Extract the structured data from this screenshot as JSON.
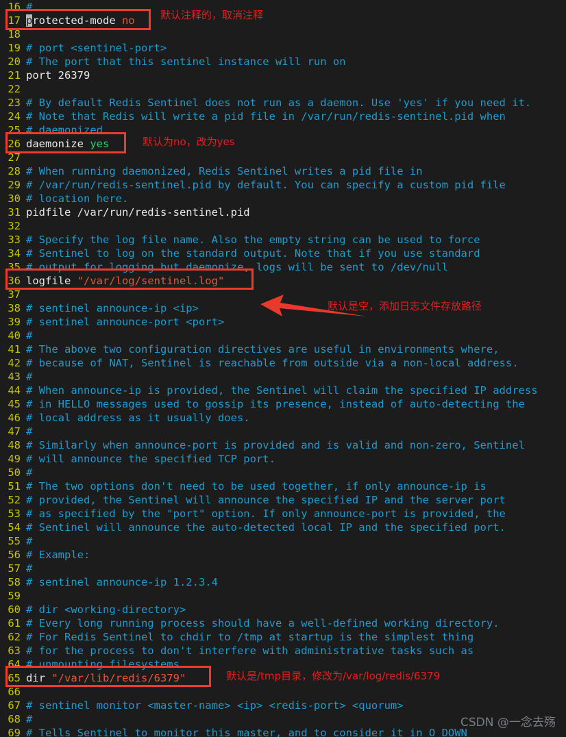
{
  "editor": {
    "file_kind": "redis-sentinel-config",
    "theme": {
      "background": "#1c1c1c",
      "line_number": "#c8c800",
      "comment": "#1e9bd0",
      "plain_text": "#e8e8e8",
      "string": "#e05a3a",
      "value_true": "#2ecc71",
      "cursor": "#b9b9b9",
      "annotation_red": "#e02020",
      "box_red": "#f03a2e"
    },
    "cursor": {
      "line": 17,
      "column": 1,
      "char": "p"
    },
    "lines": [
      {
        "n": "16",
        "segs": [
          {
            "t": "#",
            "c": "comment"
          }
        ]
      },
      {
        "n": "17",
        "segs": [
          {
            "t": "p",
            "c": "cursor"
          },
          {
            "t": "rotected-mode ",
            "c": "plain"
          },
          {
            "t": "no",
            "c": "str"
          }
        ]
      },
      {
        "n": "18",
        "segs": []
      },
      {
        "n": "19",
        "segs": [
          {
            "t": "# port <sentinel-port>",
            "c": "comment"
          }
        ]
      },
      {
        "n": "20",
        "segs": [
          {
            "t": "# The port that this sentinel instance will run on",
            "c": "comment"
          }
        ]
      },
      {
        "n": "21",
        "segs": [
          {
            "t": "port 26379",
            "c": "plain"
          }
        ]
      },
      {
        "n": "22",
        "segs": []
      },
      {
        "n": "23",
        "segs": [
          {
            "t": "# By default Redis Sentinel does not run as a daemon. Use 'yes' if you need it.",
            "c": "comment"
          }
        ]
      },
      {
        "n": "24",
        "segs": [
          {
            "t": "# Note that Redis will write a pid file in /var/run/redis-sentinel.pid when",
            "c": "comment"
          }
        ]
      },
      {
        "n": "25",
        "segs": [
          {
            "t": "# daemonized.",
            "c": "comment"
          }
        ]
      },
      {
        "n": "26",
        "segs": [
          {
            "t": "daemonize ",
            "c": "plain"
          },
          {
            "t": "yes",
            "c": "val"
          }
        ]
      },
      {
        "n": "27",
        "segs": []
      },
      {
        "n": "28",
        "segs": [
          {
            "t": "# When running daemonized, Redis Sentinel writes a pid file in",
            "c": "comment"
          }
        ]
      },
      {
        "n": "29",
        "segs": [
          {
            "t": "# /var/run/redis-sentinel.pid by default. You can specify a custom pid file",
            "c": "comment"
          }
        ]
      },
      {
        "n": "30",
        "segs": [
          {
            "t": "# location here.",
            "c": "comment"
          }
        ]
      },
      {
        "n": "31",
        "segs": [
          {
            "t": "pidfile /var/run/redis-sentinel.pid",
            "c": "plain"
          }
        ]
      },
      {
        "n": "32",
        "segs": []
      },
      {
        "n": "33",
        "segs": [
          {
            "t": "# Specify the log file name. Also the empty string can be used to force",
            "c": "comment"
          }
        ]
      },
      {
        "n": "34",
        "segs": [
          {
            "t": "# Sentinel to log on the standard output. Note that if you use standard",
            "c": "comment"
          }
        ]
      },
      {
        "n": "35",
        "segs": [
          {
            "t": "# output for logging but daemonize, logs will be sent to /dev/null",
            "c": "comment"
          }
        ]
      },
      {
        "n": "36",
        "segs": [
          {
            "t": "logfile ",
            "c": "plain"
          },
          {
            "t": "\"/var/log/sentinel.log\"",
            "c": "str"
          }
        ]
      },
      {
        "n": "37",
        "segs": []
      },
      {
        "n": "38",
        "segs": [
          {
            "t": "# sentinel announce-ip <ip>",
            "c": "comment"
          }
        ]
      },
      {
        "n": "39",
        "segs": [
          {
            "t": "# sentinel announce-port <port>",
            "c": "comment"
          }
        ]
      },
      {
        "n": "40",
        "segs": [
          {
            "t": "#",
            "c": "comment"
          }
        ]
      },
      {
        "n": "41",
        "segs": [
          {
            "t": "# The above two configuration directives are useful in environments where,",
            "c": "comment"
          }
        ]
      },
      {
        "n": "42",
        "segs": [
          {
            "t": "# because of NAT, Sentinel is reachable from outside via a non-local address.",
            "c": "comment"
          }
        ]
      },
      {
        "n": "43",
        "segs": [
          {
            "t": "#",
            "c": "comment"
          }
        ]
      },
      {
        "n": "44",
        "segs": [
          {
            "t": "# When announce-ip is provided, the Sentinel will claim the specified IP address",
            "c": "comment"
          }
        ]
      },
      {
        "n": "45",
        "segs": [
          {
            "t": "# in HELLO messages used to gossip its presence, instead of auto-detecting the",
            "c": "comment"
          }
        ]
      },
      {
        "n": "46",
        "segs": [
          {
            "t": "# local address as it usually does.",
            "c": "comment"
          }
        ]
      },
      {
        "n": "47",
        "segs": [
          {
            "t": "#",
            "c": "comment"
          }
        ]
      },
      {
        "n": "48",
        "segs": [
          {
            "t": "# Similarly when announce-port is provided and is valid and non-zero, Sentinel",
            "c": "comment"
          }
        ]
      },
      {
        "n": "49",
        "segs": [
          {
            "t": "# will announce the specified TCP port.",
            "c": "comment"
          }
        ]
      },
      {
        "n": "50",
        "segs": [
          {
            "t": "#",
            "c": "comment"
          }
        ]
      },
      {
        "n": "51",
        "segs": [
          {
            "t": "# The two options don't need to be used together, if only announce-ip is",
            "c": "comment"
          }
        ]
      },
      {
        "n": "52",
        "segs": [
          {
            "t": "# provided, the Sentinel will announce the specified IP and the server port",
            "c": "comment"
          }
        ]
      },
      {
        "n": "53",
        "segs": [
          {
            "t": "# as specified by the \"port\" option. If only announce-port is provided, the",
            "c": "comment"
          }
        ]
      },
      {
        "n": "54",
        "segs": [
          {
            "t": "# Sentinel will announce the auto-detected local IP and the specified port.",
            "c": "comment"
          }
        ]
      },
      {
        "n": "55",
        "segs": [
          {
            "t": "#",
            "c": "comment"
          }
        ]
      },
      {
        "n": "56",
        "segs": [
          {
            "t": "# Example:",
            "c": "comment"
          }
        ]
      },
      {
        "n": "57",
        "segs": [
          {
            "t": "#",
            "c": "comment"
          }
        ]
      },
      {
        "n": "58",
        "segs": [
          {
            "t": "# sentinel announce-ip 1.2.3.4",
            "c": "comment"
          }
        ]
      },
      {
        "n": "59",
        "segs": []
      },
      {
        "n": "60",
        "segs": [
          {
            "t": "# dir <working-directory>",
            "c": "comment"
          }
        ]
      },
      {
        "n": "61",
        "segs": [
          {
            "t": "# Every long running process should have a well-defined working directory.",
            "c": "comment"
          }
        ]
      },
      {
        "n": "62",
        "segs": [
          {
            "t": "# For Redis Sentinel to chdir to /tmp at startup is the simplest thing",
            "c": "comment"
          }
        ]
      },
      {
        "n": "63",
        "segs": [
          {
            "t": "# for the process to don't interfere with administrative tasks such as",
            "c": "comment"
          }
        ]
      },
      {
        "n": "64",
        "segs": [
          {
            "t": "# unmounting filesystems.",
            "c": "comment"
          }
        ]
      },
      {
        "n": "65",
        "segs": [
          {
            "t": "dir ",
            "c": "plain"
          },
          {
            "t": "\"/var/lib/redis/6379\"",
            "c": "str"
          }
        ]
      },
      {
        "n": "66",
        "segs": []
      },
      {
        "n": "67",
        "segs": [
          {
            "t": "# sentinel monitor <master-name> <ip> <redis-port> <quorum>",
            "c": "comment"
          }
        ]
      },
      {
        "n": "68",
        "segs": [
          {
            "t": "#",
            "c": "comment"
          }
        ]
      },
      {
        "n": "69",
        "segs": [
          {
            "t": "# Tells Sentinel to monitor this master, and to consider it in O_DOWN",
            "c": "comment"
          }
        ]
      }
    ]
  },
  "annotations": {
    "note_protected_mode": "默认注释的，取消注释",
    "note_daemonize": "默认为no，改为yes",
    "note_logfile": "默认是空，添加日志文件存放路径",
    "note_dir": "默认是/tmp目录，修改为/var/log/redis/6379"
  },
  "watermark": {
    "text": "CSDN @一念去殇"
  }
}
